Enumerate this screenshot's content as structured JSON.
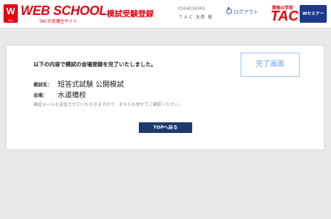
{
  "header": {
    "brand_mark": "W",
    "brand_mark_sub": "TAC",
    "brand_name": "WEB SCHOOL",
    "brand_subtitle": "TACの受講生サイト",
    "page_title": "模試受験登録",
    "user_id": "0104034305",
    "user_name": "ＴＡＣ 太郎 様",
    "logout_label": "ログアウト",
    "tac_tagline": "資格の学校",
    "tac_text": "TAC",
    "tac_badge": "Wセミナー"
  },
  "main": {
    "complete_label": "完了画面",
    "lead_text": "以下の内容で模試の会場登録を完了いたしました。",
    "exam_label": "模試名：",
    "exam_value": "短答式試験 公開模試",
    "venue_label": "会場：",
    "venue_value": "水道橋校",
    "note": "確認メールも送信させていただきますので、そちらも併せてご確認ください。",
    "top_button": "TOPへ戻る"
  },
  "colors": {
    "brand_red": "#e60012",
    "navy": "#1f3a6b",
    "link_blue": "#2a5db0"
  }
}
